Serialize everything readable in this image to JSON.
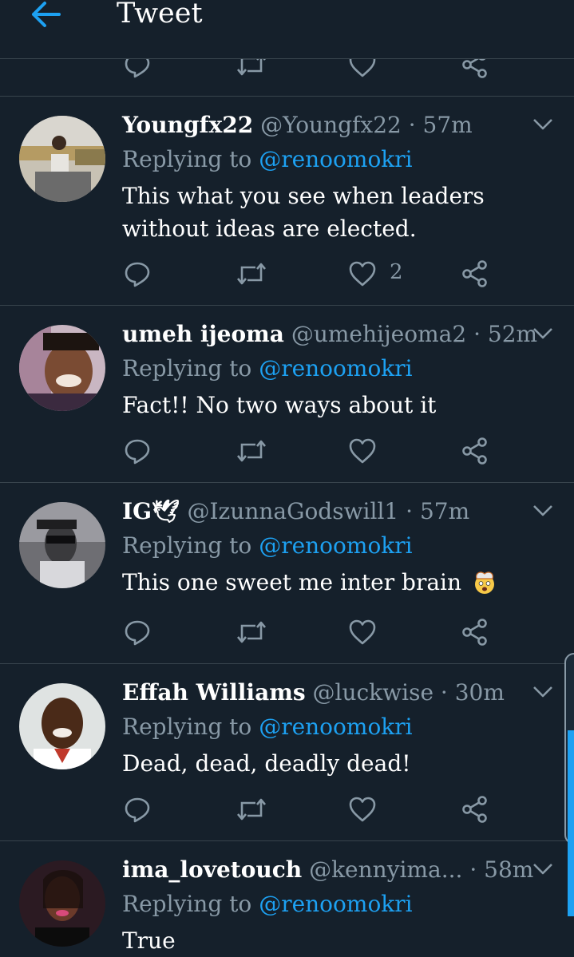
{
  "header": {
    "title": "Tweet",
    "back_icon": "arrow-left-icon",
    "accent": "#1da1f2"
  },
  "colors": {
    "background": "#15202b",
    "secondary_text": "#8899a6",
    "link": "#1da1f2",
    "divider": "#38444d"
  },
  "tweets": [
    {
      "name": "Youngfx22",
      "handle": "@Youngfx22",
      "sep": "·",
      "time": "57m",
      "replying_text": "Replying to",
      "replying_to": "@renoomokri",
      "text": "This what you see when leaders without ideas are elected.",
      "like_count": "2"
    },
    {
      "name": "umeh ijeoma",
      "handle": "@umehijeoma2",
      "sep": "·",
      "time": "52m",
      "replying_text": "Replying to",
      "replying_to": "@renoomokri",
      "text": "Fact!! No two ways about it",
      "like_count": ""
    },
    {
      "name": "IG🕊",
      "handle": "@IzunnaGodswill1",
      "sep": "·",
      "time": "57m",
      "replying_text": "Replying to",
      "replying_to": "@renoomokri",
      "text": "This one sweet me inter brain",
      "emoji": "exploding-head-emoji",
      "like_count": ""
    },
    {
      "name": "Effah Williams",
      "handle": "@luckwise",
      "sep": "·",
      "time": "30m",
      "replying_text": "Replying to",
      "replying_to": "@renoomokri",
      "text": "Dead, dead, deadly dead!",
      "like_count": ""
    },
    {
      "name": "ima_lovetouch",
      "handle": "@kennyima...",
      "sep": "·",
      "time": "58m",
      "replying_text": "Replying to",
      "replying_to": "@renoomokri",
      "text": "True",
      "like_count": ""
    }
  ],
  "icons": {
    "reply": "reply-icon",
    "retweet": "retweet-icon",
    "like": "heart-icon",
    "share": "share-icon",
    "more": "chevron-down-icon"
  }
}
